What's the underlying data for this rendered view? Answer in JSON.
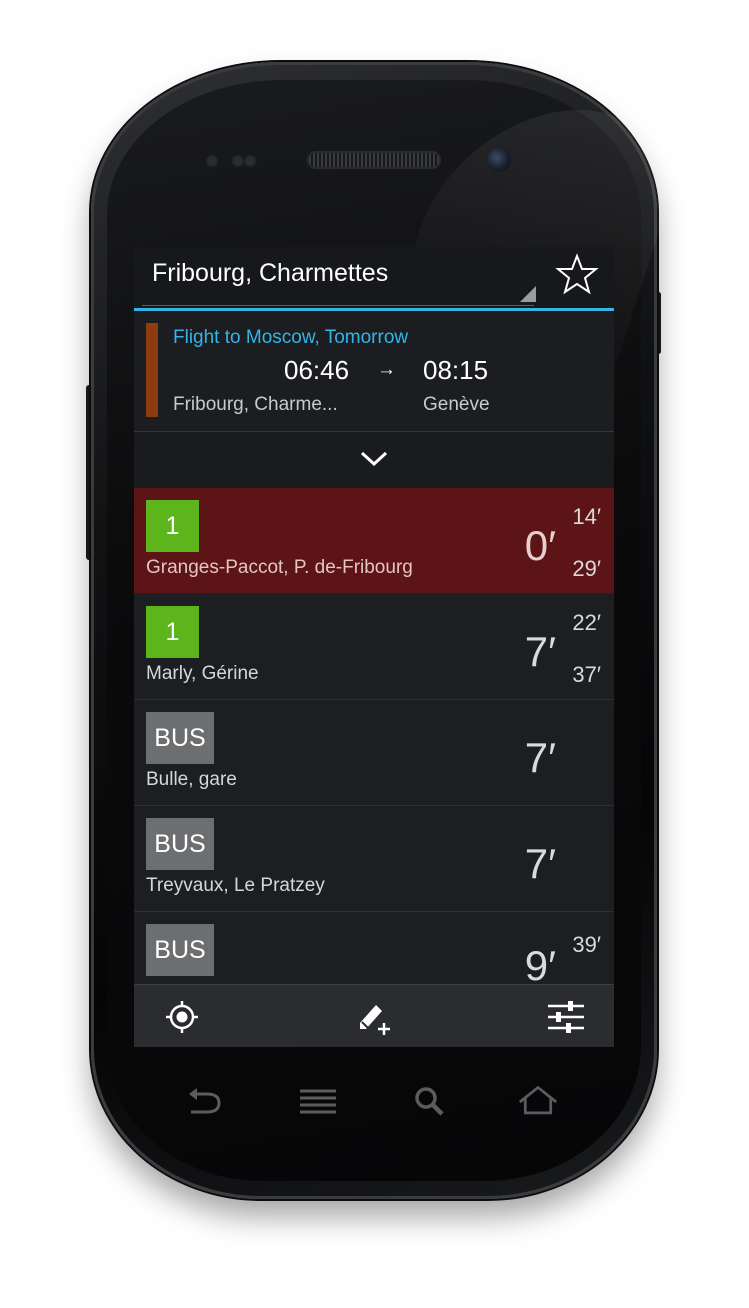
{
  "action_bar": {
    "title": "Fribourg, Charmettes",
    "favorite_icon": "star-outline-icon"
  },
  "trip": {
    "title": "Flight to Moscow, Tomorrow",
    "departure_time": "06:46",
    "arrow": "→",
    "arrival_time": "08:15",
    "from": "Fribourg, Charme...",
    "to": "Genève",
    "color": "#8e3b12"
  },
  "expand_icon": "chevron-down-icon",
  "departures": [
    {
      "line": "1",
      "badge_color": "#5cb51a",
      "destination": "Granges-Paccot, P. de-Fribourg",
      "minutes": "0′",
      "next": "14′",
      "after": "29′",
      "highlighted": true
    },
    {
      "line": "1",
      "badge_color": "#5cb51a",
      "destination": "Marly, Gérine",
      "minutes": "7′",
      "next": "22′",
      "after": "37′",
      "highlighted": false
    },
    {
      "line": "BUS",
      "badge_color": "#6d6e70",
      "destination": "Bulle, gare",
      "minutes": "7′",
      "next": "",
      "after": "",
      "highlighted": false
    },
    {
      "line": "BUS",
      "badge_color": "#6d6e70",
      "destination": "Treyvaux, Le Pratzey",
      "minutes": "7′",
      "next": "",
      "after": "",
      "highlighted": false
    },
    {
      "line": "BUS",
      "badge_color": "#6d6e70",
      "destination": "",
      "minutes": "9′",
      "next": "39′",
      "after": "",
      "highlighted": false
    }
  ],
  "bottom_bar": {
    "left_icon": "location-target-icon",
    "center_icon": "edit-add-icon",
    "right_icon": "sliders-settings-icon"
  },
  "nav": {
    "back_icon": "back-icon",
    "menu_icon": "menu-icon",
    "search_icon": "search-icon",
    "home_icon": "home-icon"
  },
  "colors": {
    "accent": "#33b5e5",
    "highlight_row": "#5d1416",
    "screen_bg": "#1b1d21"
  }
}
